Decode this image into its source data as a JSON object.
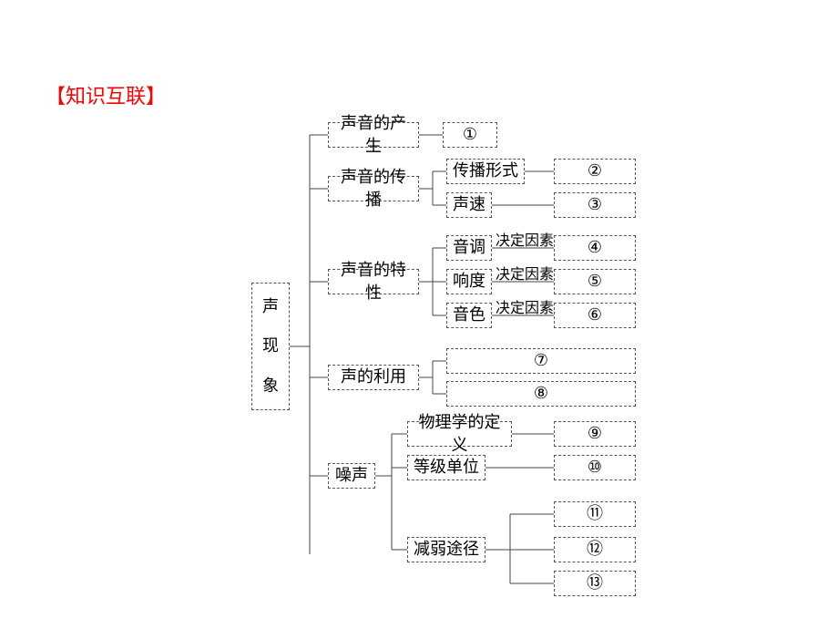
{
  "title": "【知识互联】",
  "root": "声现象",
  "nodes": {
    "sound_produce": "声音的产生",
    "sound_transmit": "声音的传播",
    "sound_feature": "声音的特性",
    "sound_use": "声的利用",
    "noise": "噪声",
    "trans_form": "传播形式",
    "sound_speed": "声速",
    "pitch": "音调",
    "loudness": "响度",
    "timbre": "音色",
    "phys_def": "物理学的定义",
    "level_unit": "等级单位",
    "weaken_path": "减弱途径"
  },
  "annotations": {
    "factor": "决定因素"
  },
  "blanks": {
    "b1": "①",
    "b2": "②",
    "b3": "③",
    "b4": "④",
    "b5": "⑤",
    "b6": "⑥",
    "b7": "⑦",
    "b8": "⑧",
    "b9": "⑨",
    "b10": "⑩",
    "b11": "⑪",
    "b12": "⑫",
    "b13": "⑬"
  }
}
